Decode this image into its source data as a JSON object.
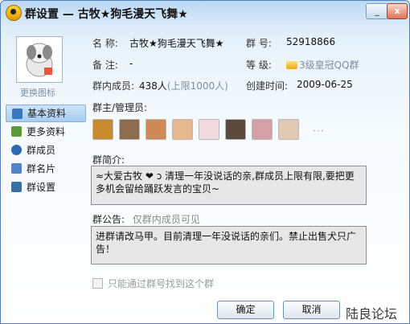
{
  "window": {
    "title": "群设置 — 古牧★狗毛漫天飞舞★",
    "minimize_glyph": "_",
    "close_glyph": "x"
  },
  "sidebar": {
    "change_icon_label": "更换图标",
    "items": [
      {
        "label": "基本资料",
        "icon": "basic-info-icon",
        "active": true
      },
      {
        "label": "更多资料",
        "icon": "more-info-icon",
        "active": false
      },
      {
        "label": "群成员",
        "icon": "members-icon",
        "active": false
      },
      {
        "label": "群名片",
        "icon": "card-icon",
        "active": false
      },
      {
        "label": "群设置",
        "icon": "settings-icon",
        "active": false
      }
    ]
  },
  "info": {
    "name_label": "名 称:",
    "name_value": "古牧★狗毛漫天飞舞★",
    "number_label": "群  号:",
    "number_value": "52918866",
    "note_label": "备 注:",
    "note_value": "-",
    "level_label": "等  级:",
    "level_value": "3级皇冠QQ群",
    "members_label": "群内成员:",
    "members_value": "438人",
    "members_limit": "(上限1000人)",
    "created_label": "创建时间:",
    "created_value": "2009-06-25"
  },
  "admins": {
    "label": "群主/管理员:",
    "more": "···",
    "avatars": [
      {
        "color": "#c88a2e"
      },
      {
        "color": "#8c6b4e"
      },
      {
        "color": "#d08a5a"
      },
      {
        "color": "#e7b78e"
      },
      {
        "color": "#f1d9e0"
      },
      {
        "color": "#5b4a3e"
      },
      {
        "color": "#d4a0a8"
      },
      {
        "color": "#e1c9b4"
      }
    ]
  },
  "intro": {
    "label": "群简介:",
    "text": "≈大爱古牧 ❤ ɔ 清理一年没说话的亲,群成员上限有限,要把更多机会留给踊跃发言的宝贝~"
  },
  "announcement": {
    "label": "群公告:",
    "note": "仅群内成员可见",
    "text": "进群请改马甲。目前清理一年没说话的亲们。禁止出售犬只广告！"
  },
  "options": {
    "search_by_number": "只能通过群号找到这个群"
  },
  "buttons": {
    "ok": "确定",
    "cancel": "取消"
  },
  "watermark": "陆良论坛"
}
